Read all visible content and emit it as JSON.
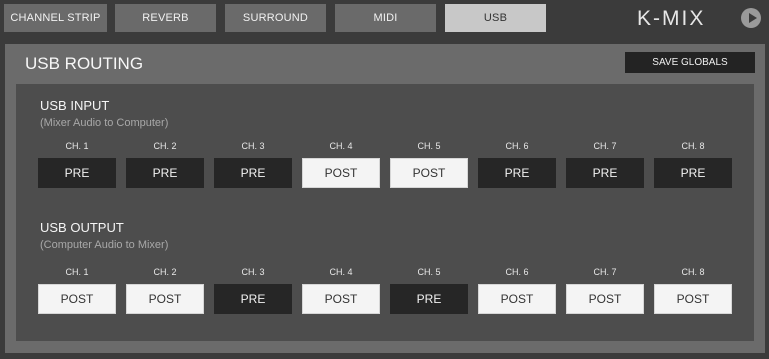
{
  "tabs": [
    {
      "label": "CHANNEL STRIP",
      "active": false
    },
    {
      "label": "REVERB",
      "active": false
    },
    {
      "label": "SURROUND",
      "active": false
    },
    {
      "label": "MIDI",
      "active": false
    },
    {
      "label": "USB",
      "active": true
    }
  ],
  "brand": "K-MIX",
  "panel": {
    "title": "USB ROUTING",
    "save_label": "SAVE GLOBALS"
  },
  "usb_input": {
    "title": "USB INPUT",
    "subtitle": "(Mixer Audio to Computer)",
    "channels": [
      {
        "label": "CH. 1",
        "mode": "PRE"
      },
      {
        "label": "CH. 2",
        "mode": "PRE"
      },
      {
        "label": "CH. 3",
        "mode": "PRE"
      },
      {
        "label": "CH. 4",
        "mode": "POST"
      },
      {
        "label": "CH. 5",
        "mode": "POST"
      },
      {
        "label": "CH. 6",
        "mode": "PRE"
      },
      {
        "label": "CH. 7",
        "mode": "PRE"
      },
      {
        "label": "CH. 8",
        "mode": "PRE"
      }
    ]
  },
  "usb_output": {
    "title": "USB OUTPUT",
    "subtitle": "(Computer Audio to Mixer)",
    "channels": [
      {
        "label": "CH. 1",
        "mode": "POST"
      },
      {
        "label": "CH. 2",
        "mode": "POST"
      },
      {
        "label": "CH. 3",
        "mode": "PRE"
      },
      {
        "label": "CH. 4",
        "mode": "POST"
      },
      {
        "label": "CH. 5",
        "mode": "PRE"
      },
      {
        "label": "CH. 6",
        "mode": "POST"
      },
      {
        "label": "CH. 7",
        "mode": "POST"
      },
      {
        "label": "CH. 8",
        "mode": "POST"
      }
    ]
  }
}
